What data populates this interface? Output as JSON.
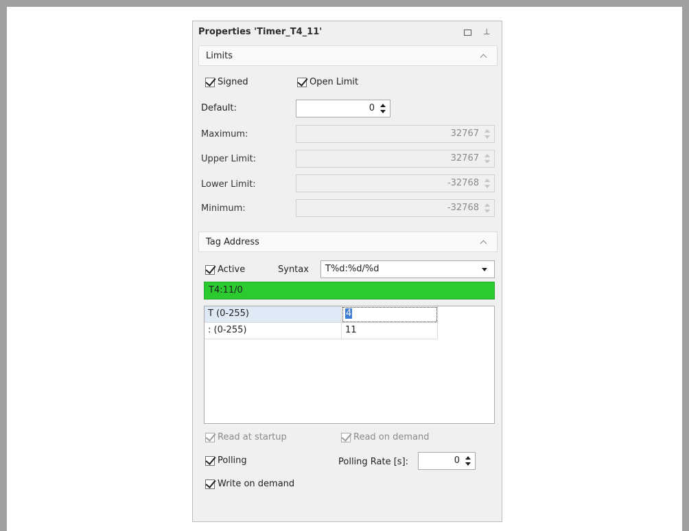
{
  "panel": {
    "title": "Properties 'Timer_T4_11'"
  },
  "limits": {
    "header": "Limits",
    "signed": {
      "label": "Signed",
      "checked": true
    },
    "open_limit": {
      "label": "Open Limit",
      "checked": true
    },
    "default": {
      "label": "Default:",
      "value": "0"
    },
    "maximum": {
      "label": "Maximum:",
      "value": "32767"
    },
    "upper_limit": {
      "label": "Upper Limit:",
      "value": "32767"
    },
    "lower_limit": {
      "label": "Lower Limit:",
      "value": "-32768"
    },
    "minimum": {
      "label": "Minimum:",
      "value": "-32768"
    }
  },
  "tag_address": {
    "header": "Tag Address",
    "active": {
      "label": "Active",
      "checked": true
    },
    "syntax": {
      "label": "Syntax",
      "value": "T%d:%d/%d"
    },
    "address": "T4:11/0",
    "address_color": "#2bcb30",
    "rows": [
      {
        "name": "T (0-255)",
        "value": "4"
      },
      {
        "name": ": (0-255)",
        "value": "11"
      }
    ],
    "read_at_startup": {
      "label": "Read at startup",
      "checked": true
    },
    "read_on_demand": {
      "label": "Read on demand",
      "checked": true
    },
    "polling": {
      "label": "Polling",
      "checked": true
    },
    "polling_rate": {
      "label": "Polling Rate [s]:",
      "value": "0"
    },
    "write_on_demand": {
      "label": "Write on demand",
      "checked": true
    }
  }
}
